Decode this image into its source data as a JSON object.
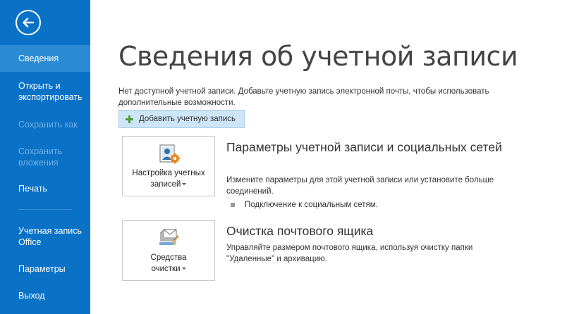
{
  "sidebar": {
    "items": [
      {
        "label": "Сведения"
      },
      {
        "label": "Открыть и экспортировать"
      },
      {
        "label": "Сохранить как"
      },
      {
        "label": "Сохранить вложения"
      },
      {
        "label": "Печать"
      },
      {
        "label": "Учетная запись Office"
      },
      {
        "label": "Параметры"
      },
      {
        "label": "Выход"
      }
    ],
    "active_color": "#2a8ad4",
    "background_color": "#0a72c6"
  },
  "main": {
    "title": "Сведения об учетной записи",
    "intro": "Нет доступной учетной записи. Добавьте учетную запись электронной почты, чтобы использовать дополнительные возможности.",
    "add_account_label": "Добавить учетную запись",
    "sections": [
      {
        "tile_line1": "Настройка учетных",
        "tile_line2": "записей",
        "title": "Параметры учетной записи и социальных сетей",
        "description": "Измените параметры для этой учетной записи или установите больше соединений.",
        "bullet": "Подключение к социальным сетям."
      },
      {
        "tile_line1": "Средства",
        "tile_line2": "очистки",
        "title": "Очистка почтового ящика",
        "description": "Управляйте размером почтового ящика, используя очистку папки \"Удаленные\" и архивацию."
      }
    ]
  }
}
